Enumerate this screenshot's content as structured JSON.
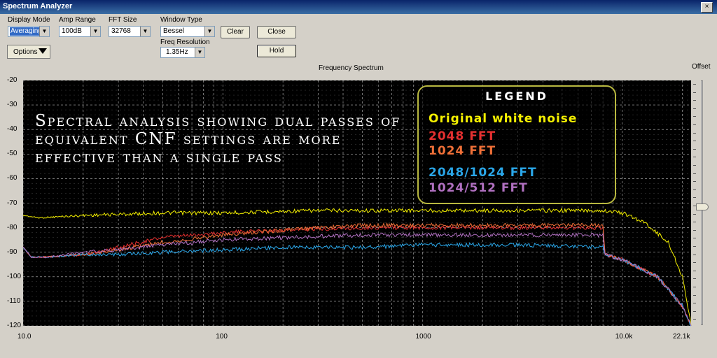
{
  "window": {
    "title": "Spectrum Analyzer",
    "close_glyph": "×"
  },
  "controls": {
    "display_mode": {
      "label": "Display Mode",
      "value": "Averaging"
    },
    "amp_range": {
      "label": "Amp Range",
      "value": "100dB"
    },
    "fft_size": {
      "label": "FFT Size",
      "value": "32768"
    },
    "window_type": {
      "label": "Window Type",
      "value": "Bessel"
    },
    "freq_resolution": {
      "label": "Freq Resolution",
      "value": "1.35Hz"
    },
    "clear": "Clear",
    "close": "Close",
    "hold": "Hold",
    "options": "Options"
  },
  "chart_title": "Frequency Spectrum",
  "offset_label": "Offset",
  "overlay_text": "Spectral analysis showing dual passes of equivalent CNF settings are more effective than a single pass",
  "legend": {
    "title": "LEGEND",
    "items": [
      {
        "label": "Original white noise",
        "color": "#f4f000"
      },
      {
        "label": "2048 FFT",
        "color": "#e53030"
      },
      {
        "label": "1024 FFT",
        "color": "#f07038"
      },
      {
        "label": "2048/1024 FFT",
        "color": "#2aa6e8"
      },
      {
        "label": "1024/512 FFT",
        "color": "#b070c0"
      }
    ]
  },
  "chart_data": {
    "type": "line",
    "title": "Frequency Spectrum",
    "x_scale": "log",
    "xlim": [
      10,
      22100
    ],
    "ylim": [
      -120,
      -20
    ],
    "x_tick_labels": [
      "10.0",
      "100",
      "1000",
      "10.0k",
      "22.1k"
    ],
    "y_tick_labels": [
      "-20",
      "-30",
      "-40",
      "-50",
      "-60",
      "-70",
      "-80",
      "-90",
      "-100",
      "-110",
      "-120"
    ],
    "grid": true,
    "background": "#000000",
    "series": [
      {
        "name": "Original white noise",
        "color": "#f4f000",
        "x": [
          10,
          12,
          20,
          50,
          100,
          300,
          1000,
          3000,
          8000,
          10000,
          13000,
          17000,
          20000,
          22100
        ],
        "y": [
          -75,
          -76,
          -75,
          -74,
          -74,
          -73,
          -73,
          -73,
          -73,
          -74,
          -78,
          -86,
          -100,
          -120
        ]
      },
      {
        "name": "2048 FFT",
        "color": "#e53030",
        "x": [
          10,
          11,
          13,
          20,
          30,
          50,
          100,
          200,
          500,
          1000,
          3000,
          8000,
          8200,
          10000,
          15000,
          20000,
          22100
        ],
        "y": [
          -88,
          -92,
          -92,
          -91,
          -88,
          -84,
          -82,
          -81,
          -80,
          -80,
          -80,
          -80,
          -91,
          -93,
          -100,
          -112,
          -120
        ]
      },
      {
        "name": "1024 FFT",
        "color": "#f07038",
        "x": [
          10,
          11,
          13,
          20,
          30,
          50,
          100,
          200,
          500,
          1000,
          3000,
          8000,
          8200,
          10000,
          15000,
          20000,
          22100
        ],
        "y": [
          -88,
          -92,
          -92,
          -91,
          -89,
          -86,
          -83,
          -81,
          -79,
          -79,
          -79,
          -79,
          -91,
          -93,
          -100,
          -112,
          -120
        ]
      },
      {
        "name": "2048/1024 FFT",
        "color": "#2aa6e8",
        "x": [
          10,
          11,
          13,
          20,
          30,
          50,
          100,
          200,
          500,
          1000,
          3000,
          8000,
          8200,
          10000,
          15000,
          20000,
          22100
        ],
        "y": [
          -88,
          -92,
          -92,
          -91,
          -91,
          -90,
          -89,
          -88,
          -88,
          -87,
          -87,
          -88,
          -91,
          -93,
          -100,
          -112,
          -120
        ]
      },
      {
        "name": "1024/512 FFT",
        "color": "#b070c0",
        "x": [
          10,
          11,
          13,
          20,
          30,
          50,
          100,
          200,
          500,
          1000,
          3000,
          8000,
          8200,
          10000,
          15000,
          20000,
          22100
        ],
        "y": [
          -88,
          -92,
          -92,
          -90,
          -89,
          -87,
          -85,
          -84,
          -83,
          -83,
          -83,
          -83,
          -91,
          -93,
          -100,
          -112,
          -120
        ]
      }
    ]
  }
}
